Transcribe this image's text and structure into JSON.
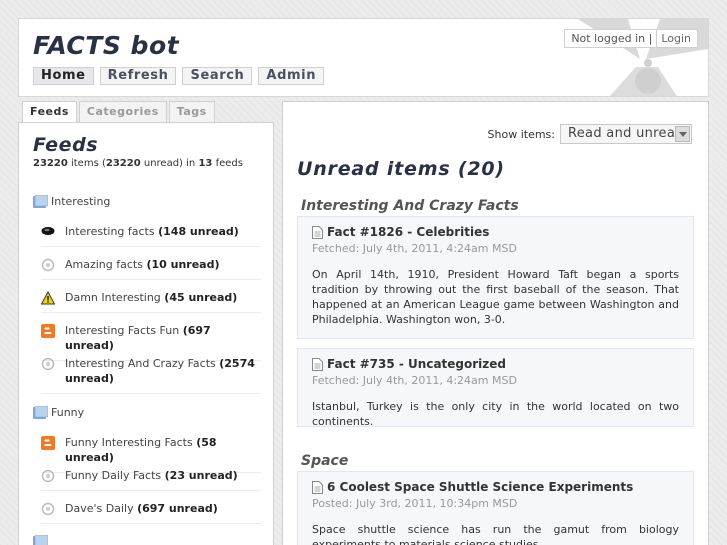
{
  "header": {
    "site_title": "FACTS bot",
    "nav": [
      "Home",
      "Refresh",
      "Search",
      "Admin"
    ],
    "login_status": "Not logged in |",
    "login_link": "Login"
  },
  "sidebar": {
    "tabs": [
      "Feeds",
      "Categories",
      "Tags"
    ],
    "title": "Feeds",
    "summary": {
      "items": "23220",
      "items_label": "items (",
      "unread": "23220",
      "unread_label": "unread) in",
      "feeds": "13",
      "feeds_label": "feeds"
    },
    "folders": [
      {
        "name": "Interesting",
        "feeds": [
          {
            "name": "Interesting facts",
            "count": "(148 unread)",
            "icon": "black-blob-icon"
          },
          {
            "name": "Amazing facts",
            "count": "(10 unread)",
            "icon": "gray-circle-icon"
          },
          {
            "name": "Damn Interesting",
            "count": "(45 unread)",
            "icon": "warning-triangle-icon"
          },
          {
            "name": "Interesting Facts Fun",
            "count": "(697 unread)",
            "icon": "blogger-icon"
          },
          {
            "name": "Interesting And Crazy Facts",
            "count": "(2574 unread)",
            "icon": "gray-circle-icon"
          }
        ]
      },
      {
        "name": "Funny",
        "feeds": [
          {
            "name": "Funny Interesting Facts",
            "count": "(58 unread)",
            "icon": "blogger-icon"
          },
          {
            "name": "Funny Daily Facts",
            "count": "(23 unread)",
            "icon": "gray-circle-icon"
          },
          {
            "name": "Dave's Daily",
            "count": "(697 unread)",
            "icon": "gray-circle-icon"
          }
        ]
      }
    ]
  },
  "main": {
    "show_items_label": "Show items:",
    "show_items_value": "Read and unread",
    "title": "Unread items (20)",
    "groups": [
      {
        "title": "Interesting And Crazy Facts",
        "articles": [
          {
            "title": "Fact #1826 - Celebrities",
            "meta": "Fetched: July 4th, 2011, 4:24am MSD",
            "body": "On April 14th, 1910, President Howard Taft began a sports tradition by throwing out the first baseball of the season. That happened at an American League game between Washington and Philadelphia. Washington won, 3-0."
          },
          {
            "title": "Fact #735 - Uncategorized",
            "meta": "Fetched: July 4th, 2011, 4:24am MSD",
            "body": "Istanbul, Turkey is the only city in the world located on two continents."
          }
        ]
      },
      {
        "title": "Space",
        "articles": [
          {
            "title": "6 Coolest Space Shuttle Science Experiments",
            "meta": "Posted: July 3rd, 2011, 10:34pm MSD",
            "body": "Space shuttle science has run the gamut from biology experiments to materials science studies."
          }
        ]
      }
    ]
  },
  "colors": {
    "title": "#2a3144",
    "article_bg": "#f5f7fb",
    "blogger": "#f07b23",
    "warning": "#f4d400"
  }
}
